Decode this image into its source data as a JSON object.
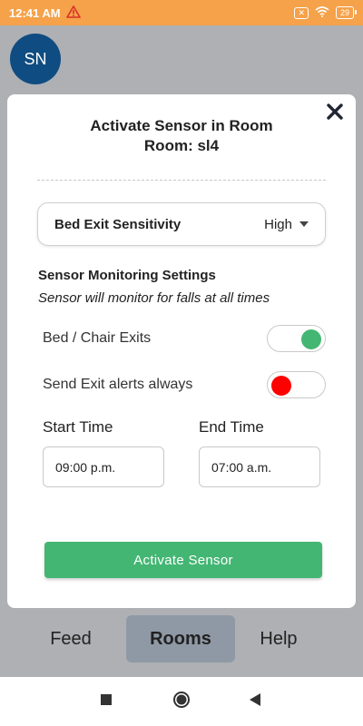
{
  "status_bar": {
    "time": "12:41 AM",
    "warning_icon": "warning-triangle-icon",
    "sim_icon": "no-sim-icon",
    "wifi_icon": "wifi-icon",
    "battery": "29"
  },
  "avatar": {
    "initials": "SN",
    "color": "#0f4c81"
  },
  "modal": {
    "title_line1": "Activate Sensor in Room",
    "title_line2": "Room: sl4",
    "close_icon": "close-icon",
    "sensitivity": {
      "label": "Bed Exit Sensitivity",
      "value": "High"
    },
    "section_title": "Sensor Monitoring Settings",
    "section_subtitle": "Sensor will monitor for falls at all times",
    "toggles": [
      {
        "label": "Bed / Chair Exits",
        "on": true,
        "color": "#43b673"
      },
      {
        "label": "Send Exit alerts always",
        "on": false,
        "color": "#ff0000"
      }
    ],
    "start_time": {
      "label": "Start Time",
      "value": "09:00 p.m."
    },
    "end_time": {
      "label": "End Time",
      "value": "07:00 a.m."
    },
    "activate_button": "Activate Sensor"
  },
  "tabs": [
    {
      "label": "Feed",
      "active": false
    },
    {
      "label": "Rooms",
      "active": true
    },
    {
      "label": "Help",
      "active": false
    }
  ],
  "nav": {
    "recents_icon": "square-icon",
    "home_icon": "circle-home-icon",
    "back_icon": "back-triangle-icon"
  },
  "colors": {
    "status_bar": "#f5a24a",
    "accent_green": "#43b673",
    "alert_red": "#ff0000",
    "backdrop": "#aeb0b4"
  }
}
